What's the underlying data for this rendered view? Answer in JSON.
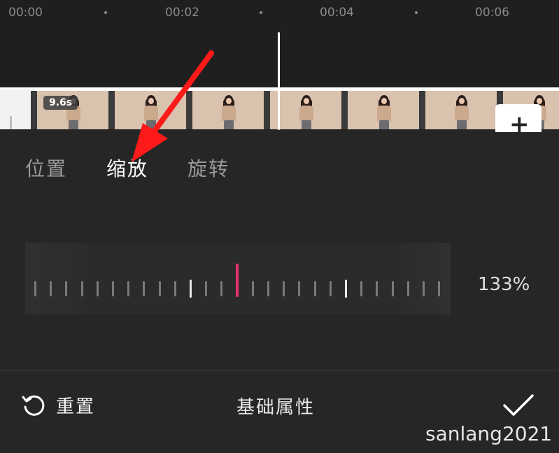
{
  "ruler": {
    "times": [
      "00:00",
      "00:02",
      "00:04",
      "00:06"
    ]
  },
  "clip": {
    "duration_badge": "9.6s",
    "add_label": "+"
  },
  "tabs": [
    {
      "label": "位置",
      "active": false
    },
    {
      "label": "缩放",
      "active": true
    },
    {
      "label": "旋转",
      "active": false
    }
  ],
  "scale": {
    "value_text": "133%",
    "value_percent": 133,
    "indicator_color": "#e5306b"
  },
  "bottom": {
    "reset_label": "重置",
    "title": "基础属性"
  },
  "watermark": "sanlang2021",
  "annotation": {
    "arrow_color": "#ff1a1a"
  },
  "icons": {
    "reset": "reset-icon",
    "confirm": "checkmark-icon",
    "add": "plus-icon"
  }
}
